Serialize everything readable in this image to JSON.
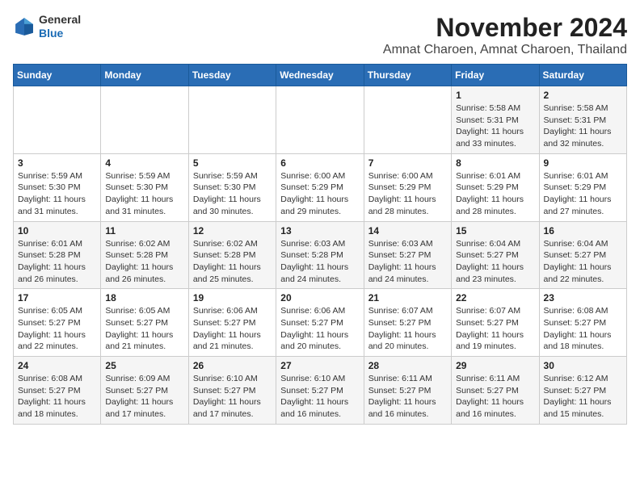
{
  "header": {
    "logo_line1": "General",
    "logo_line2": "Blue",
    "title": "November 2024",
    "subtitle": "Amnat Charoen, Amnat Charoen, Thailand"
  },
  "weekdays": [
    "Sunday",
    "Monday",
    "Tuesday",
    "Wednesday",
    "Thursday",
    "Friday",
    "Saturday"
  ],
  "weeks": [
    [
      {
        "date": "",
        "info": ""
      },
      {
        "date": "",
        "info": ""
      },
      {
        "date": "",
        "info": ""
      },
      {
        "date": "",
        "info": ""
      },
      {
        "date": "",
        "info": ""
      },
      {
        "date": "1",
        "info": "Sunrise: 5:58 AM\nSunset: 5:31 PM\nDaylight: 11 hours\nand 33 minutes."
      },
      {
        "date": "2",
        "info": "Sunrise: 5:58 AM\nSunset: 5:31 PM\nDaylight: 11 hours\nand 32 minutes."
      }
    ],
    [
      {
        "date": "3",
        "info": "Sunrise: 5:59 AM\nSunset: 5:30 PM\nDaylight: 11 hours\nand 31 minutes."
      },
      {
        "date": "4",
        "info": "Sunrise: 5:59 AM\nSunset: 5:30 PM\nDaylight: 11 hours\nand 31 minutes."
      },
      {
        "date": "5",
        "info": "Sunrise: 5:59 AM\nSunset: 5:30 PM\nDaylight: 11 hours\nand 30 minutes."
      },
      {
        "date": "6",
        "info": "Sunrise: 6:00 AM\nSunset: 5:29 PM\nDaylight: 11 hours\nand 29 minutes."
      },
      {
        "date": "7",
        "info": "Sunrise: 6:00 AM\nSunset: 5:29 PM\nDaylight: 11 hours\nand 28 minutes."
      },
      {
        "date": "8",
        "info": "Sunrise: 6:01 AM\nSunset: 5:29 PM\nDaylight: 11 hours\nand 28 minutes."
      },
      {
        "date": "9",
        "info": "Sunrise: 6:01 AM\nSunset: 5:29 PM\nDaylight: 11 hours\nand 27 minutes."
      }
    ],
    [
      {
        "date": "10",
        "info": "Sunrise: 6:01 AM\nSunset: 5:28 PM\nDaylight: 11 hours\nand 26 minutes."
      },
      {
        "date": "11",
        "info": "Sunrise: 6:02 AM\nSunset: 5:28 PM\nDaylight: 11 hours\nand 26 minutes."
      },
      {
        "date": "12",
        "info": "Sunrise: 6:02 AM\nSunset: 5:28 PM\nDaylight: 11 hours\nand 25 minutes."
      },
      {
        "date": "13",
        "info": "Sunrise: 6:03 AM\nSunset: 5:28 PM\nDaylight: 11 hours\nand 24 minutes."
      },
      {
        "date": "14",
        "info": "Sunrise: 6:03 AM\nSunset: 5:27 PM\nDaylight: 11 hours\nand 24 minutes."
      },
      {
        "date": "15",
        "info": "Sunrise: 6:04 AM\nSunset: 5:27 PM\nDaylight: 11 hours\nand 23 minutes."
      },
      {
        "date": "16",
        "info": "Sunrise: 6:04 AM\nSunset: 5:27 PM\nDaylight: 11 hours\nand 22 minutes."
      }
    ],
    [
      {
        "date": "17",
        "info": "Sunrise: 6:05 AM\nSunset: 5:27 PM\nDaylight: 11 hours\nand 22 minutes."
      },
      {
        "date": "18",
        "info": "Sunrise: 6:05 AM\nSunset: 5:27 PM\nDaylight: 11 hours\nand 21 minutes."
      },
      {
        "date": "19",
        "info": "Sunrise: 6:06 AM\nSunset: 5:27 PM\nDaylight: 11 hours\nand 21 minutes."
      },
      {
        "date": "20",
        "info": "Sunrise: 6:06 AM\nSunset: 5:27 PM\nDaylight: 11 hours\nand 20 minutes."
      },
      {
        "date": "21",
        "info": "Sunrise: 6:07 AM\nSunset: 5:27 PM\nDaylight: 11 hours\nand 20 minutes."
      },
      {
        "date": "22",
        "info": "Sunrise: 6:07 AM\nSunset: 5:27 PM\nDaylight: 11 hours\nand 19 minutes."
      },
      {
        "date": "23",
        "info": "Sunrise: 6:08 AM\nSunset: 5:27 PM\nDaylight: 11 hours\nand 18 minutes."
      }
    ],
    [
      {
        "date": "24",
        "info": "Sunrise: 6:08 AM\nSunset: 5:27 PM\nDaylight: 11 hours\nand 18 minutes."
      },
      {
        "date": "25",
        "info": "Sunrise: 6:09 AM\nSunset: 5:27 PM\nDaylight: 11 hours\nand 17 minutes."
      },
      {
        "date": "26",
        "info": "Sunrise: 6:10 AM\nSunset: 5:27 PM\nDaylight: 11 hours\nand 17 minutes."
      },
      {
        "date": "27",
        "info": "Sunrise: 6:10 AM\nSunset: 5:27 PM\nDaylight: 11 hours\nand 16 minutes."
      },
      {
        "date": "28",
        "info": "Sunrise: 6:11 AM\nSunset: 5:27 PM\nDaylight: 11 hours\nand 16 minutes."
      },
      {
        "date": "29",
        "info": "Sunrise: 6:11 AM\nSunset: 5:27 PM\nDaylight: 11 hours\nand 16 minutes."
      },
      {
        "date": "30",
        "info": "Sunrise: 6:12 AM\nSunset: 5:27 PM\nDaylight: 11 hours\nand 15 minutes."
      }
    ]
  ]
}
